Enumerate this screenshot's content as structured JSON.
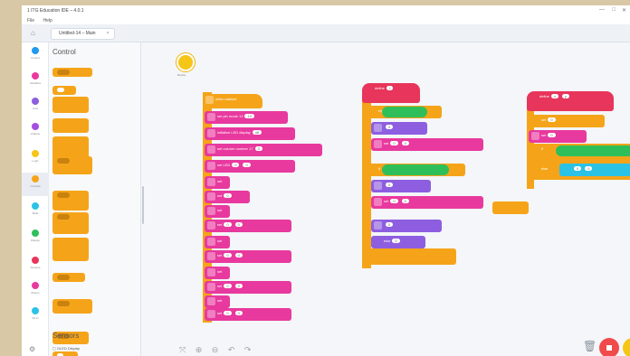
{
  "window": {
    "title": "1 ITG Education IDE – 4.0.1",
    "menu": [
      "File",
      "Help"
    ],
    "tab_label": "Untitled-14 – Main"
  },
  "categories": [
    {
      "name": "Control",
      "color": "#1e9af0"
    },
    {
      "name": "Variables",
      "color": "#e8399e"
    },
    {
      "name": "Lists",
      "color": "#8e5ee0"
    },
    {
      "name": "Arduino",
      "color": "#a64ee0"
    },
    {
      "name": "Logic",
      "color": "#f5c518"
    },
    {
      "name": "Controls",
      "color": "#f5a419"
    },
    {
      "name": "Math",
      "color": "#2cc2e5"
    },
    {
      "name": "Display",
      "color": "#2fbf5a"
    },
    {
      "name": "Sensors",
      "color": "#e8355b"
    },
    {
      "name": "Motors",
      "color": "#e8399e"
    },
    {
      "name": "Wi-Fi",
      "color": "#2cc2e5"
    }
  ],
  "palette": {
    "title": "Control",
    "footer_title": "Sensors",
    "sensor_item": "OLED Display"
  },
  "device": {
    "label": "Device"
  },
  "scripts": {
    "main_hat": "when started",
    "main_blocks": [
      "set pin mode 13",
      "initialize LED display",
      "set column number 17",
      "set LED",
      "set",
      "set",
      "set",
      "set",
      "set",
      "set",
      "set",
      "set",
      "set",
      "set"
    ],
    "func_hat": "define",
    "func_blocks": [
      "repeat",
      "if",
      "set",
      "set",
      "set",
      "set",
      "set",
      "else",
      "set",
      "set",
      "set",
      "set"
    ],
    "right_hat": "define",
    "right_blocks": [
      "set",
      "set",
      "if",
      "else"
    ]
  }
}
